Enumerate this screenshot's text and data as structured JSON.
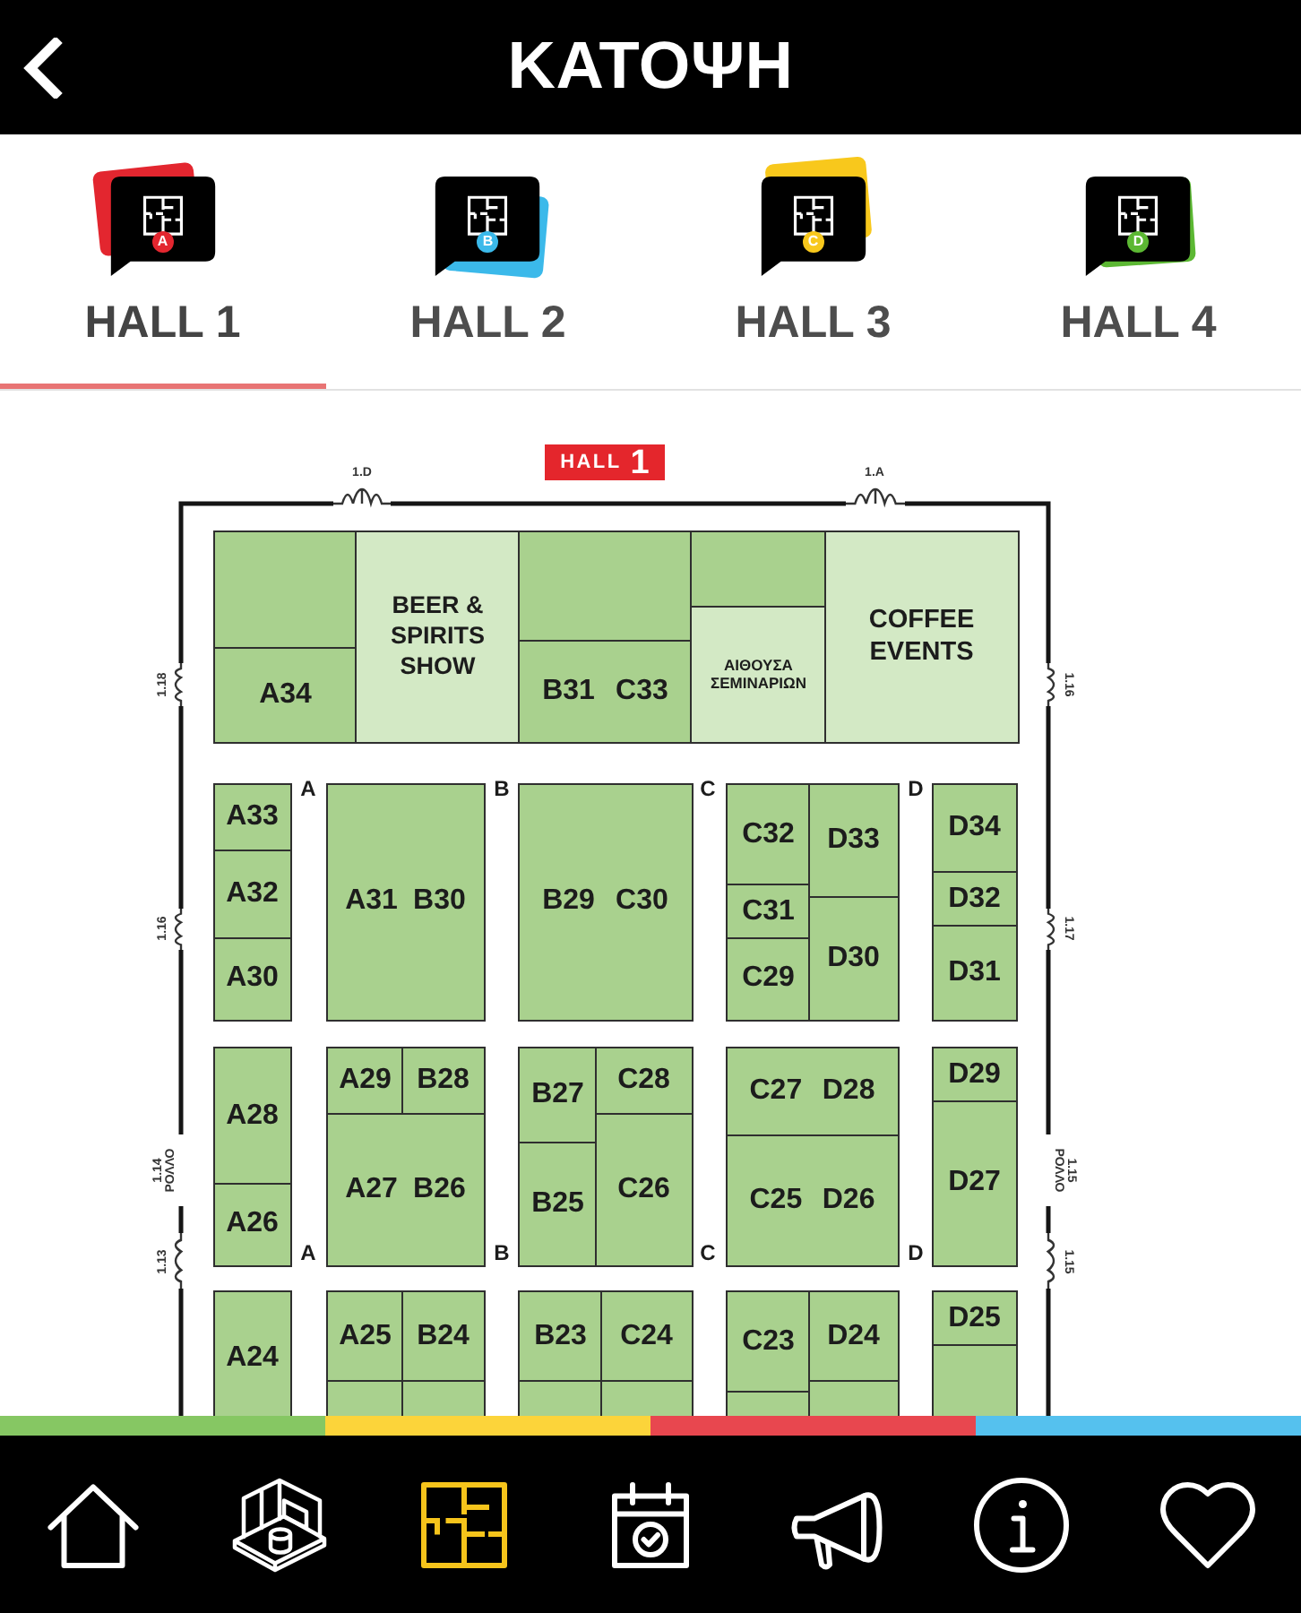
{
  "header": {
    "title": "ΚΑΤΟΨΗ"
  },
  "tabs": [
    {
      "label": "HALL 1",
      "badge": "A",
      "color": "#e3262f",
      "selected": true
    },
    {
      "label": "HALL 2",
      "badge": "B",
      "color": "#3bb9ea",
      "selected": false
    },
    {
      "label": "HALL 3",
      "badge": "C",
      "color": "#f8c81c",
      "selected": false
    },
    {
      "label": "HALL 4",
      "badge": "D",
      "color": "#5cb833",
      "selected": false
    }
  ],
  "floor_plan": {
    "sign": {
      "label": "HALL",
      "number": "1"
    },
    "doors": [
      {
        "kind": "door",
        "label": "1.D"
      },
      {
        "kind": "door",
        "label": "1.A"
      },
      {
        "kind": "door",
        "label": "1.18"
      },
      {
        "kind": "door",
        "label": "1.16"
      },
      {
        "kind": "roller",
        "label": "1.14 ΡΟΛΛΟ"
      },
      {
        "kind": "door",
        "label": "1.13"
      },
      {
        "kind": "door",
        "label": "1.16"
      },
      {
        "kind": "door",
        "label": "1.17"
      },
      {
        "kind": "roller",
        "label": "1.15 ΡΟΛΛΟ"
      },
      {
        "kind": "door",
        "label": "1.15"
      }
    ],
    "aisles": [
      "A",
      "B",
      "C",
      "D",
      "A",
      "B",
      "C",
      "D"
    ],
    "booths": [
      {
        "kind": "stand"
      },
      {
        "kind": "stand",
        "labels": [
          "A34"
        ]
      },
      {
        "kind": "area",
        "labels": [
          "BEER & SPIRITS SHOW"
        ]
      },
      {
        "kind": "stand"
      },
      {
        "kind": "stand",
        "labels": [
          "B31",
          "C33"
        ]
      },
      {
        "kind": "stand"
      },
      {
        "kind": "area",
        "labels": [
          "ΑΙΘΟΥΣΑ ΣΕΜΙΝΑΡΙΩΝ"
        ]
      },
      {
        "kind": "area",
        "labels": [
          "COFFEE EVENTS"
        ]
      },
      {
        "kind": "stand",
        "labels": [
          "A33"
        ]
      },
      {
        "kind": "stand",
        "labels": [
          "A32"
        ]
      },
      {
        "kind": "stand",
        "labels": [
          "A30"
        ]
      },
      {
        "kind": "stand",
        "labels": [
          "A31",
          "B30"
        ]
      },
      {
        "kind": "stand",
        "labels": [
          "B29",
          "C30"
        ]
      },
      {
        "kind": "stand",
        "labels": [
          "C32"
        ]
      },
      {
        "kind": "stand",
        "labels": [
          "C31"
        ]
      },
      {
        "kind": "stand",
        "labels": [
          "C29"
        ]
      },
      {
        "kind": "stand",
        "labels": [
          "D33"
        ]
      },
      {
        "kind": "stand",
        "labels": [
          "D30"
        ]
      },
      {
        "kind": "stand",
        "labels": [
          "D34"
        ]
      },
      {
        "kind": "stand",
        "labels": [
          "D32"
        ]
      },
      {
        "kind": "stand",
        "labels": [
          "D31"
        ]
      },
      {
        "kind": "stand",
        "labels": [
          "A28"
        ]
      },
      {
        "kind": "stand",
        "labels": [
          "A26"
        ]
      },
      {
        "kind": "stand",
        "labels": [
          "A29"
        ]
      },
      {
        "kind": "stand",
        "labels": [
          "B28"
        ]
      },
      {
        "kind": "stand",
        "labels": [
          "A27",
          "B26"
        ]
      },
      {
        "kind": "stand",
        "labels": [
          "B27"
        ]
      },
      {
        "kind": "stand",
        "labels": [
          "B25"
        ]
      },
      {
        "kind": "stand",
        "labels": [
          "C28"
        ]
      },
      {
        "kind": "stand",
        "labels": [
          "C26"
        ]
      },
      {
        "kind": "stand",
        "labels": [
          "C27",
          "D28"
        ]
      },
      {
        "kind": "stand",
        "labels": [
          "C25",
          "D26"
        ]
      },
      {
        "kind": "stand",
        "labels": [
          "D29"
        ]
      },
      {
        "kind": "stand",
        "labels": [
          "D27"
        ]
      },
      {
        "kind": "stand",
        "labels": [
          "A24"
        ]
      },
      {
        "kind": "stand",
        "labels": [
          "A25"
        ]
      },
      {
        "kind": "stand",
        "labels": [
          "B24"
        ]
      },
      {
        "kind": "stand"
      },
      {
        "kind": "stand"
      },
      {
        "kind": "stand",
        "labels": [
          "B23"
        ]
      },
      {
        "kind": "stand",
        "labels": [
          "C24"
        ]
      },
      {
        "kind": "stand"
      },
      {
        "kind": "stand"
      },
      {
        "kind": "stand",
        "labels": [
          "C23"
        ]
      },
      {
        "kind": "stand",
        "labels": [
          "D24"
        ]
      },
      {
        "kind": "stand"
      },
      {
        "kind": "stand"
      },
      {
        "kind": "stand",
        "labels": [
          "D25"
        ]
      },
      {
        "kind": "stand"
      }
    ]
  },
  "nav": [
    {
      "selected": false
    },
    {
      "selected": false
    },
    {
      "selected": true
    },
    {
      "selected": false
    },
    {
      "selected": false
    },
    {
      "selected": false
    },
    {
      "selected": false
    }
  ]
}
